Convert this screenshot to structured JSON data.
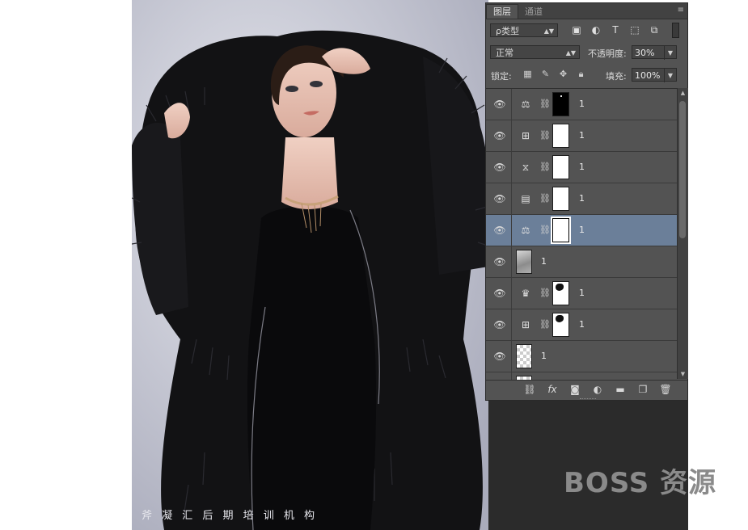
{
  "photo": {
    "watermark": "斧 凝 汇 后 期 培 训 机 构"
  },
  "brand_watermark": "BOSS 资源",
  "panel": {
    "tabs": [
      {
        "label": "图层",
        "active": true
      },
      {
        "label": "通道",
        "active": false
      }
    ],
    "menu_icon": "≡",
    "filter": {
      "kind_label": "ρ类型",
      "icons": [
        "image-filter-icon",
        "adjustment-filter-icon",
        "type-filter-icon",
        "shape-filter-icon",
        "smart-object-filter-icon"
      ]
    },
    "blend": {
      "mode": "正常",
      "opacity_label": "不透明度:",
      "opacity_value": "30%"
    },
    "lock": {
      "label": "锁定:",
      "fill_label": "填充:",
      "fill_value": "100%"
    },
    "layers": [
      {
        "type": "adjustment",
        "icon": "balance-icon",
        "glyph": "⚖",
        "mask": "black",
        "name": "1",
        "selected": false
      },
      {
        "type": "adjustment",
        "icon": "curves-icon",
        "glyph": "⊞",
        "mask": "white",
        "name": "1",
        "selected": false
      },
      {
        "type": "adjustment",
        "icon": "channel-mixer-icon",
        "glyph": "⧖",
        "mask": "white",
        "name": "1",
        "selected": false
      },
      {
        "type": "adjustment",
        "icon": "levels-icon",
        "glyph": "▤",
        "mask": "white",
        "name": "1",
        "selected": false
      },
      {
        "type": "adjustment",
        "icon": "balance-icon",
        "glyph": "⚖",
        "mask": "white",
        "name": "1",
        "selected": true
      },
      {
        "type": "pixel",
        "thumb": "image",
        "name": "1",
        "selected": false
      },
      {
        "type": "adjustment",
        "icon": "histogram-icon",
        "glyph": "♛",
        "mask": "white-spot",
        "name": "1",
        "selected": false
      },
      {
        "type": "adjustment",
        "icon": "curves-icon",
        "glyph": "⊞",
        "mask": "white-spot",
        "name": "1",
        "selected": false
      },
      {
        "type": "pixel",
        "thumb": "transparent",
        "name": "1",
        "selected": false
      },
      {
        "type": "pixel",
        "thumb": "transparent",
        "name": "",
        "selected": false
      }
    ],
    "bottom_icons": [
      "link-icon",
      "fx-icon",
      "mask-icon",
      "new-adjustment-icon",
      "folder-icon",
      "new-layer-icon",
      "trash-icon"
    ]
  },
  "colors": {
    "panel_bg": "#535353",
    "selected_row": "#6b7f99",
    "dark_area": "#2b2b2b"
  }
}
